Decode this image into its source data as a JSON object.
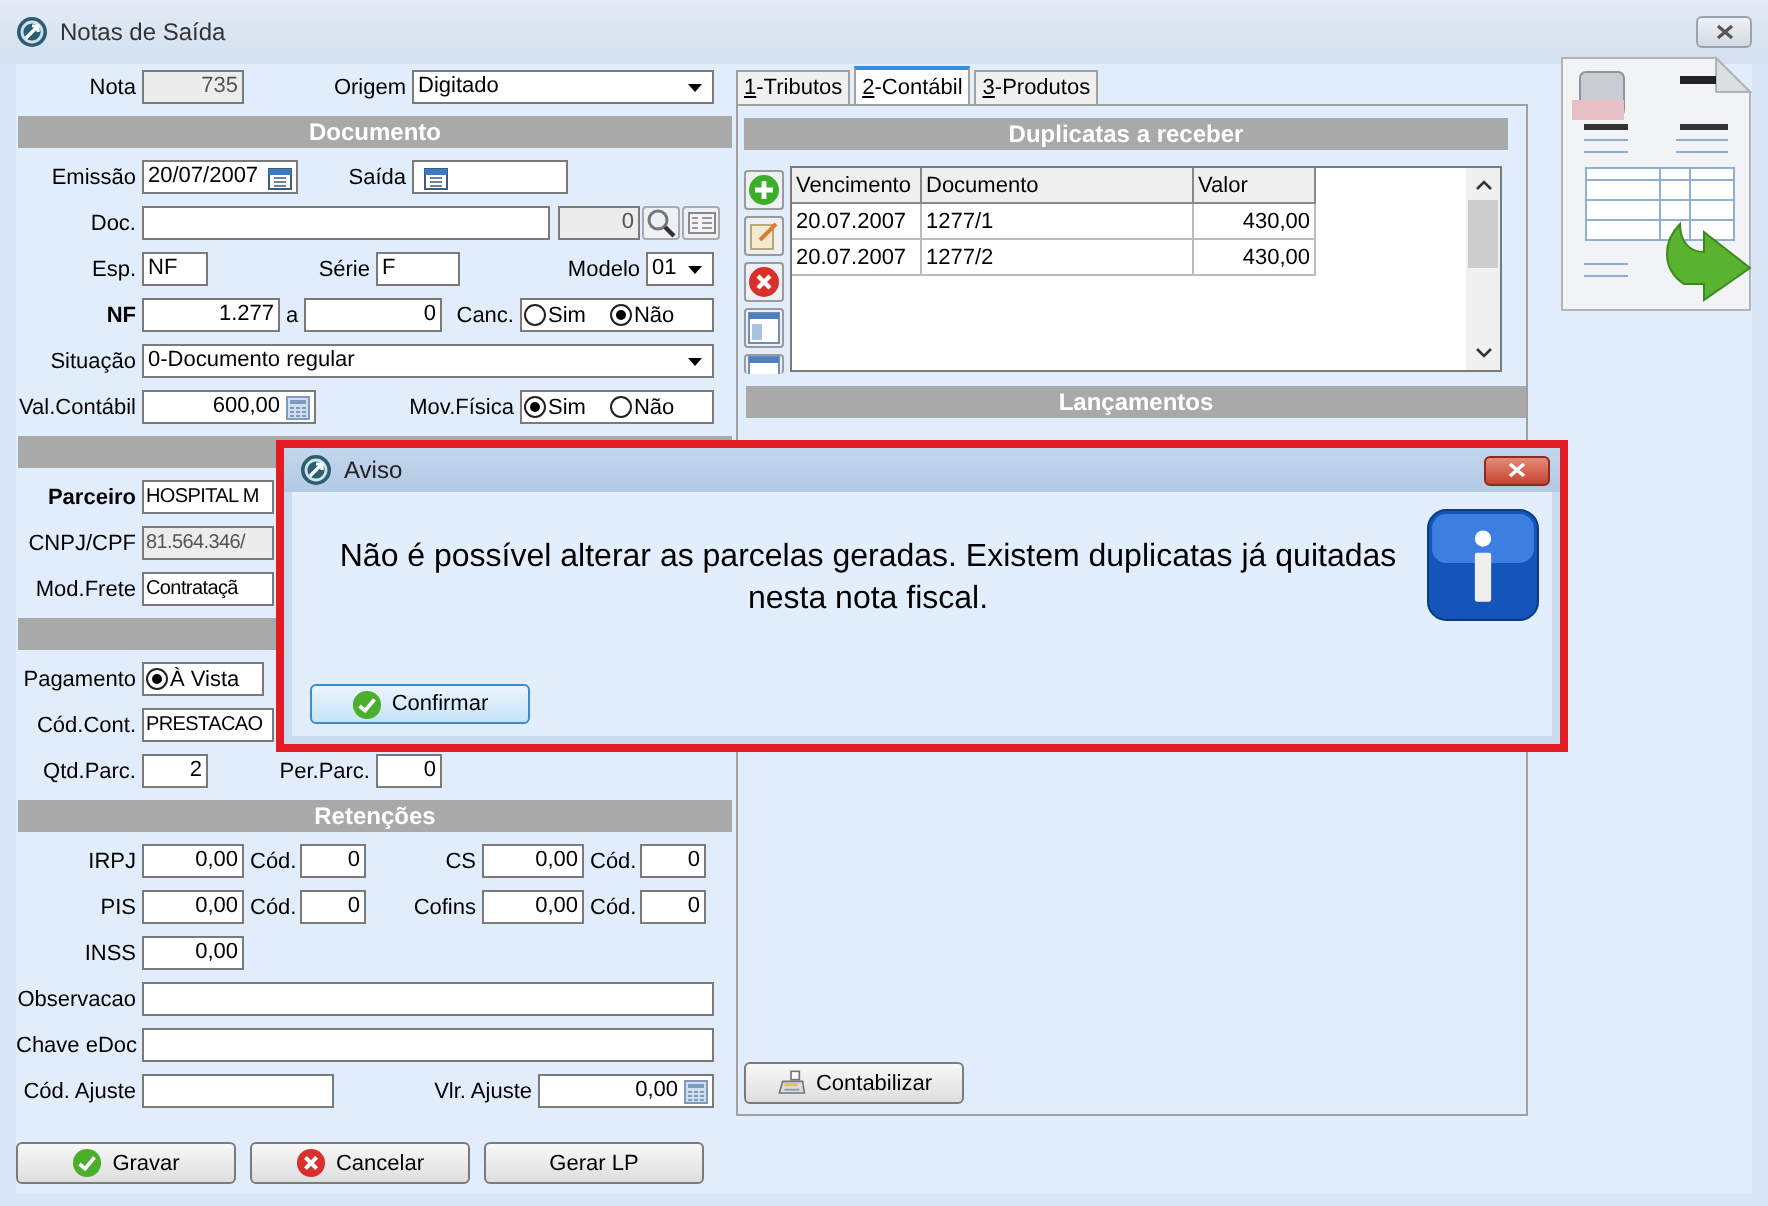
{
  "window": {
    "title": "Notas de Saída"
  },
  "form": {
    "nota": {
      "label": "Nota",
      "value": "735"
    },
    "origem": {
      "label": "Origem",
      "value": "Digitado"
    },
    "documento_header": "Documento",
    "emissao": {
      "label": "Emissão",
      "value": "20/07/2007"
    },
    "saida": {
      "label": "Saída"
    },
    "doc": {
      "label": "Doc.",
      "number": "0"
    },
    "esp": {
      "label": "Esp.",
      "value": "NF"
    },
    "serie": {
      "label": "Série",
      "value": "F"
    },
    "modelo": {
      "label": "Modelo",
      "value": "01"
    },
    "nf": {
      "label": "NF",
      "from": "1.277",
      "to_label": "a",
      "to": "0"
    },
    "canc": {
      "label": "Canc.",
      "options": [
        {
          "label": "Sim",
          "selected": false
        },
        {
          "label": "Não",
          "selected": true
        }
      ]
    },
    "situacao": {
      "label": "Situação",
      "value": "0-Documento regular"
    },
    "val_contabil": {
      "label": "Val.Contábil",
      "value": "600,00"
    },
    "mov_fisica": {
      "label": "Mov.Física",
      "options": [
        {
          "label": "Sim",
          "selected": true
        },
        {
          "label": "Não",
          "selected": false
        }
      ]
    },
    "parceiro": {
      "label": "Parceiro",
      "value": "HOSPITAL M"
    },
    "cnpj_cpf": {
      "label": "CNPJ/CPF",
      "value": "81.564.346/"
    },
    "mod_frete": {
      "label": "Mod.Frete",
      "value": "Contrataçã"
    },
    "pagamento": {
      "label": "Pagamento",
      "options": [
        {
          "label": "À Vista",
          "selected": true
        }
      ]
    },
    "cod_cont": {
      "label": "Cód.Cont.",
      "value": "PRESTACAO"
    },
    "qtd_parc": {
      "label": "Qtd.Parc.",
      "value": "2"
    },
    "per_parc": {
      "label": "Per.Parc.",
      "value": "0"
    },
    "retencoes_header": "Retenções",
    "retencoes": [
      {
        "label": "IRPJ",
        "value": "0,00",
        "cod_label": "Cód.",
        "cod": "0"
      },
      {
        "label": "CS",
        "value": "0,00",
        "cod_label": "Cód.",
        "cod": "0"
      },
      {
        "label": "PIS",
        "value": "0,00",
        "cod_label": "Cód.",
        "cod": "0"
      },
      {
        "label": "Cofins",
        "value": "0,00",
        "cod_label": "Cód.",
        "cod": "0"
      },
      {
        "label": "INSS",
        "value": "0,00"
      }
    ],
    "observacao": {
      "label": "Observacao"
    },
    "chave_edoc": {
      "label": "Chave eDoc"
    },
    "cod_ajuste": {
      "label": "Cód. Ajuste"
    },
    "vlr_ajuste": {
      "label": "Vlr. Ajuste",
      "value": "0,00"
    }
  },
  "buttons": [
    {
      "label": "Gravar",
      "kind": "ok"
    },
    {
      "label": "Cancelar",
      "kind": "cancel"
    },
    {
      "label": "Gerar LP",
      "kind": "plain"
    }
  ],
  "tabs": [
    {
      "label": "1-Tributos",
      "selected": false
    },
    {
      "label": "2-Contábil",
      "selected": true
    },
    {
      "label": "3-Produtos",
      "selected": false
    }
  ],
  "duplicatas": {
    "title": "Duplicatas a receber",
    "columns": [
      "Vencimento",
      "Documento",
      "Valor"
    ],
    "rows": [
      [
        "20.07.2007",
        "1277/1",
        "430,00"
      ],
      [
        "20.07.2007",
        "1277/2",
        "430,00"
      ]
    ]
  },
  "lancamentos": {
    "title": "Lançamentos"
  },
  "contabilizar": "Contabilizar",
  "dialog": {
    "title": "Aviso",
    "message": "Não é possível alterar as parcelas geradas. Existem duplicatas já quitadas nesta nota fiscal.",
    "button": "Confirmar"
  }
}
